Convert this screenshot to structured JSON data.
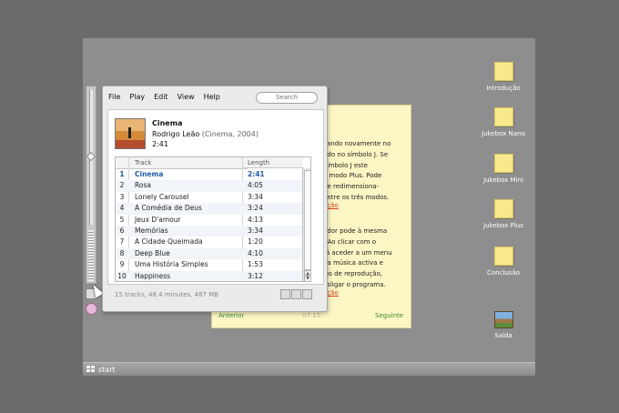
{
  "taskbar": {
    "start_label": "start"
  },
  "desktop_icons": [
    {
      "label": "Introdução"
    },
    {
      "label": "Jukebox Nano"
    },
    {
      "label": "Jukebox Mini"
    },
    {
      "label": "Jukebox Plus"
    },
    {
      "label": "Conclusão"
    },
    {
      "label": "Saída"
    }
  ],
  "note": {
    "lines": [
      "cando novamente no",
      "ndo no símbolo J. Se",
      "símbolo J este",
      "a modo Plus. Pode",
      "de redimensiona-",
      " entre os três modos."
    ],
    "link1": "ação",
    "lines2": [
      "ador pode à mesma",
      ". Ao clicar com o",
      "rá aceder a um menu",
      "da música activa e",
      "los de reprodução,",
      "esligar o programa."
    ],
    "link2": "ação",
    "prev": "Anterior",
    "time": "07:15",
    "next": "Seguinte"
  },
  "jukebox": {
    "menu": [
      "File",
      "Play",
      "Edit",
      "View",
      "Help"
    ],
    "search_placeholder": "Search",
    "album": {
      "title": "Cinema",
      "artist": "Rodrigo Leão",
      "album_year": "(Cinema, 2004)",
      "length": "2:41"
    },
    "columns": {
      "track": "Track",
      "length": "Length"
    },
    "tracks": [
      {
        "n": "1",
        "title": "Cinema",
        "length": "2:41",
        "active": true
      },
      {
        "n": "2",
        "title": "Rosa",
        "length": "4:05"
      },
      {
        "n": "3",
        "title": "Lonely Carousel",
        "length": "3:34"
      },
      {
        "n": "4",
        "title": "A Comédia de Deus",
        "length": "3:24"
      },
      {
        "n": "5",
        "title": "Jeux D'amour",
        "length": "4:13"
      },
      {
        "n": "6",
        "title": "Memórias",
        "length": "3:34"
      },
      {
        "n": "7",
        "title": "A Cidade Queimada",
        "length": "1:20"
      },
      {
        "n": "8",
        "title": "Deep Blue",
        "length": "4:10"
      },
      {
        "n": "9",
        "title": "Uma História Simples",
        "length": "1:53"
      },
      {
        "n": "10",
        "title": "Happiness",
        "length": "3:12"
      }
    ],
    "summary": "15 tracks, 48.4 minutes, 487 MB"
  },
  "colors": {
    "active_track": "#1e5da8",
    "note_bg": "#fbf6c4",
    "desktop": "#8e8e8e"
  }
}
